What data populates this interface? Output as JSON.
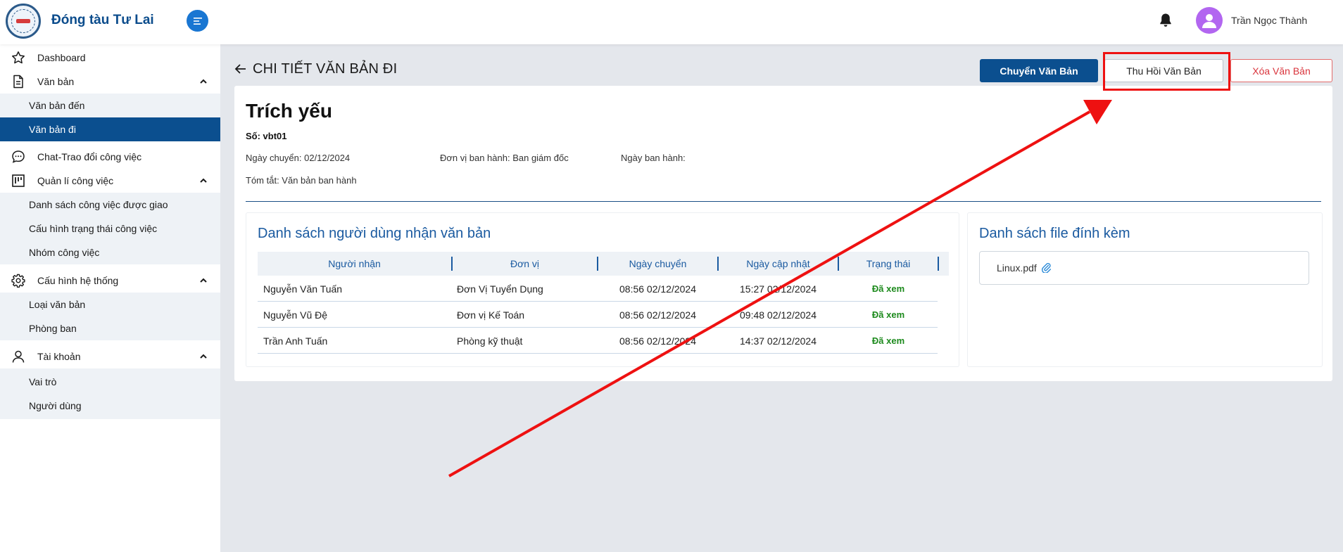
{
  "header": {
    "app_title": "Đóng tàu Tư Lai",
    "logo_icon": "ship-logo",
    "menu_icon": "menu-toggle-icon",
    "bell_icon": "bell-icon",
    "avatar_icon": "user-avatar-icon",
    "user_name": "Trần Ngọc Thành",
    "colors": {
      "brand": "#0b4c8c",
      "toggle": "#1976d2",
      "avatar": "#b266f0"
    }
  },
  "sidebar": {
    "dashboard": "Dashboard",
    "van_ban": {
      "label": "Văn bản",
      "items": [
        "Văn bản đến",
        "Văn bản đi"
      ],
      "active": "Văn bản đi"
    },
    "chat": "Chat-Trao đổi công việc",
    "quan_li": {
      "label": "Quản lí công việc",
      "items": [
        "Danh sách công việc được giao",
        "Cấu hình trạng thái công việc",
        "Nhóm công việc"
      ]
    },
    "cau_hinh": {
      "label": "Cấu hình hệ thống",
      "items": [
        "Loại văn bản",
        "Phòng ban"
      ]
    },
    "tai_khoan": {
      "label": "Tài khoản",
      "items": [
        "Vai trò",
        "Người dùng"
      ]
    },
    "active_color": "#0b4f8f"
  },
  "page": {
    "heading": "CHI TIẾT VĂN BẢN ĐI",
    "buttons": {
      "transfer": "Chuyển Văn Bản",
      "recall": "Thu Hồi Văn Bản",
      "delete": "Xóa Văn Bản"
    },
    "doc": {
      "title": "Trích yếu",
      "number": "Số: vbt01",
      "transfer_date": "Ngày chuyển: 02/12/2024",
      "issuer": "Đơn vị ban hành: Ban giám đốc",
      "issue_date": "Ngày ban hành:",
      "summary": "Tóm tắt: Văn bản ban hành"
    },
    "recipients": {
      "title": "Danh sách người dùng nhận văn bản",
      "columns": [
        "Người nhận",
        "Đơn vị",
        "Ngày chuyển",
        "Ngày cập nhật",
        "Trạng thái"
      ],
      "rows": [
        [
          "Nguyễn Văn Tuấn",
          "Đơn Vị Tuyển Dụng",
          "08:56 02/12/2024",
          "15:27 02/12/2024",
          "Đã xem"
        ],
        [
          "Nguyễn Vũ Đệ",
          "Đơn vị Kế Toán",
          "08:56 02/12/2024",
          "09:48 02/12/2024",
          "Đã xem"
        ],
        [
          "Trần Anh Tuấn",
          "Phòng kỹ thuật",
          "08:56 02/12/2024",
          "14:37 02/12/2024",
          "Đã xem"
        ]
      ],
      "status_color": "#1c8a1c"
    },
    "attachments": {
      "title": "Danh sách file đính kèm",
      "files": [
        "Linux.pdf"
      ],
      "file_icon": "paperclip-icon"
    }
  },
  "annotation": {
    "color": "#ee1111",
    "target": "Thu Hồi Văn Bản"
  }
}
